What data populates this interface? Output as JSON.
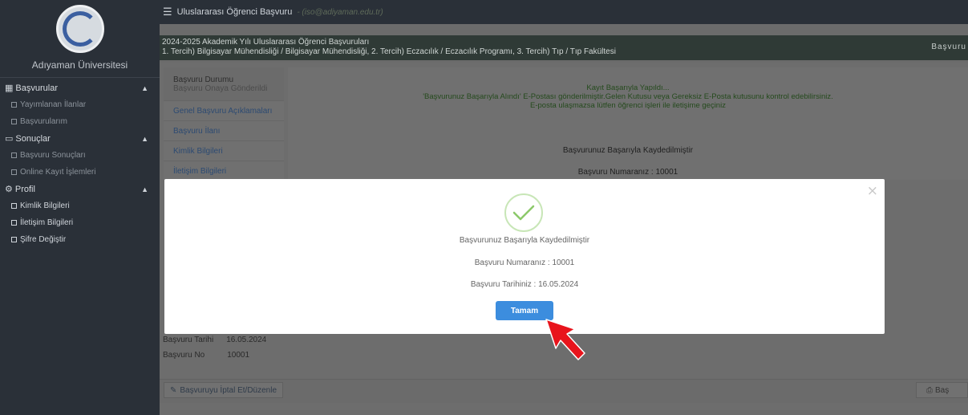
{
  "sidebar": {
    "university_name": "Adıyaman Üniversitesi",
    "groups": [
      {
        "label": "Başvurular",
        "icon": "grid-icon",
        "items": [
          "Yayımlanan İlanlar",
          "Başvurularım"
        ]
      },
      {
        "label": "Sonuçlar",
        "icon": "inbox-icon",
        "items": [
          "Başvuru Sonuçları",
          "Online Kayıt İşlemleri"
        ]
      },
      {
        "label": "Profil",
        "icon": "cogs-icon",
        "items": [
          "Kimlik Bilgileri",
          "İletişim Bilgileri",
          "Şifre Değiştir"
        ]
      }
    ]
  },
  "topbar": {
    "title": "Uluslararası Öğrenci Başvuru",
    "email": "- (iso@adiyaman.edu.tr)"
  },
  "subheader": {
    "line1": "2024-2025 Akademik Yılı Uluslararası Öğrenci Başvuruları",
    "line2": "1. Tercih) Bilgisayar Mühendisliği / Bilgisayar Mühendisliği, 2. Tercih) Eczacılık / Eczacılık Programı, 3. Tercih) Tıp / Tıp Fakültesi",
    "right_label": "Başvuru"
  },
  "tabs": {
    "status_title": "Başvuru Durumu",
    "status_sub": "Başvuru Onaya Gönderildi",
    "items": [
      "Genel Başvuru Açıklamaları",
      "Başvuru İlanı",
      "Kimlik Bilgileri",
      "İletişim Bilgileri"
    ]
  },
  "panel": {
    "success_1": "Kayıt Başarıyla Yapıldı...",
    "success_2": "'Başvurunuz Başarıyla Alındı' E-Postası gönderilmiştir.Gelen Kutusu veya Gereksiz E-Posta kutusunu kontrol edebilirsiniz.",
    "success_3": "E-posta ulaşmazsa lütfen öğrenci işleri ile iletişime geçiniz",
    "saved": "Başvurunuz Başarıyla Kaydedilmiştir",
    "number": "Başvuru Numaranız : 10001"
  },
  "info": {
    "date_label": "Başvuru Tarihi",
    "date_value": "16.05.2024",
    "no_label": "Başvuru No",
    "no_value": "10001"
  },
  "footer": {
    "cancel_label": "Başvuruyu İptal Et/Düzenle",
    "print_label": "Baş"
  },
  "modal": {
    "message": "Başvurunuz Başarıyla Kaydedilmiştir",
    "number": "Başvuru Numaranız : 10001",
    "date": "Başvuru Tarihiniz : 16.05.2024",
    "ok_label": "Tamam",
    "close_glyph": "×"
  },
  "colors": {
    "sidebar_bg": "#2a3038",
    "primary_button": "#3c8dde",
    "success_check": "#8cc96a",
    "pointer": "#e8141c"
  }
}
